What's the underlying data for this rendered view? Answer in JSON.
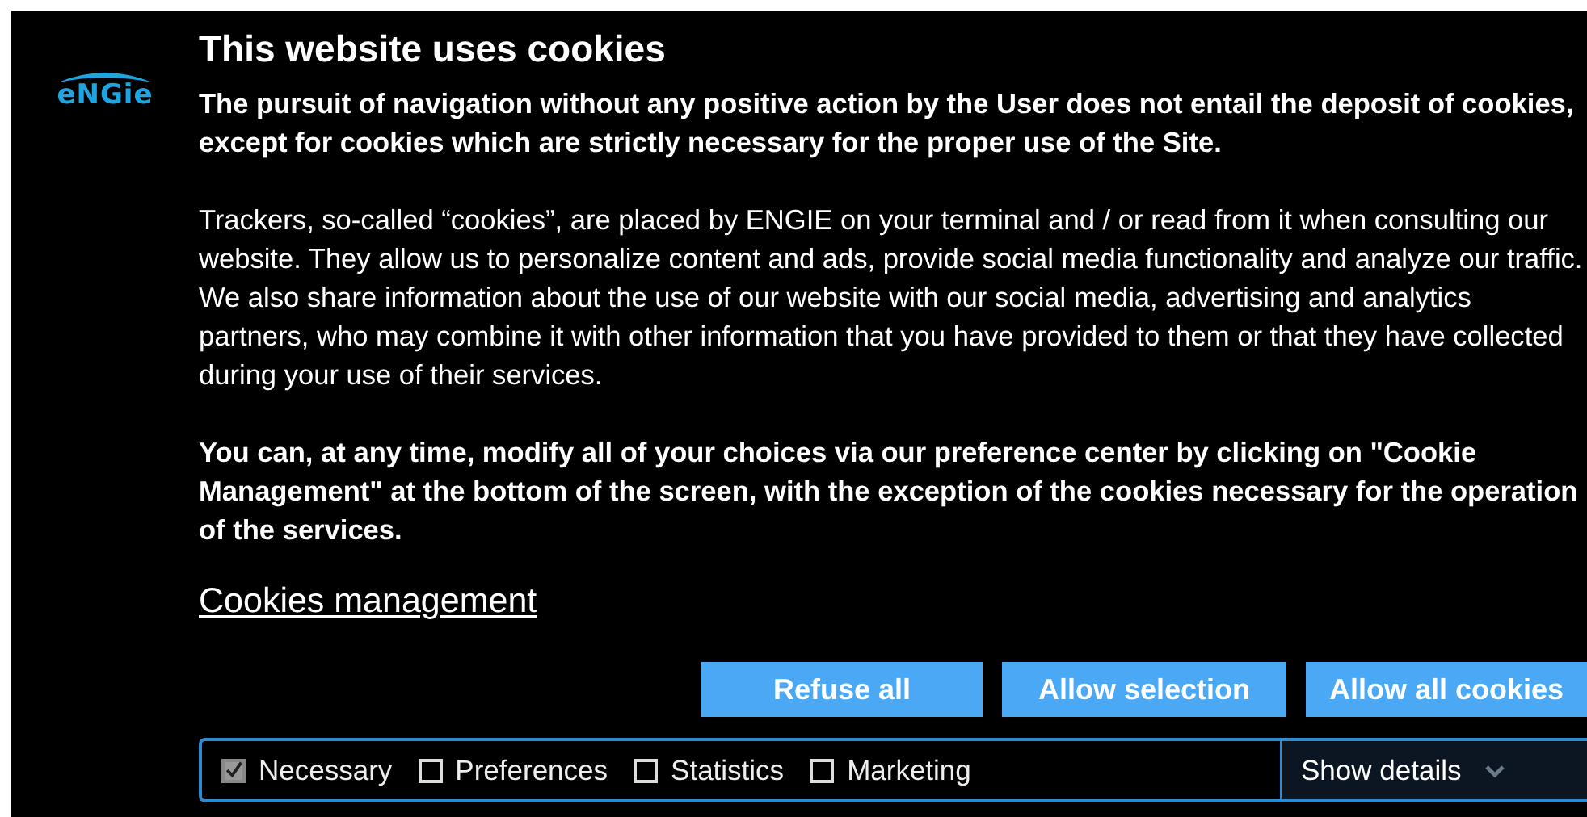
{
  "logo": "eNGie",
  "title": "This website uses cookies",
  "paragraphs": [
    {
      "kind": "bold",
      "text": "The pursuit of navigation without any positive action by the User does not entail the deposit of cookies, except for cookies which are strictly necessary for the proper use of the Site."
    },
    {
      "kind": "normal",
      "text": "Trackers, so-called “cookies”, are placed by ENGIE on your terminal and / or read from it when consulting our website. They allow us to personalize content and ads, provide social media functionality and analyze our traffic. We also share information about the use of our website with our social media, advertising and analytics partners, who may combine it with other information that you have provided to them or that they have collected during your use of their services."
    },
    {
      "kind": "bold",
      "text": "You can, at any time, modify all of your choices via our preference center by clicking on \"Cookie Management\" at the bottom of the screen, with the exception of the cookies necessary for the operation of the services."
    }
  ],
  "management_link": "Cookies management",
  "buttons": [
    "Refuse all",
    "Allow selection",
    "Allow all cookies"
  ],
  "categories": [
    {
      "label": "Necessary",
      "checked": true,
      "disabled": true
    },
    {
      "label": "Preferences",
      "checked": false,
      "disabled": false
    },
    {
      "label": "Statistics",
      "checked": false,
      "disabled": false
    },
    {
      "label": "Marketing",
      "checked": false,
      "disabled": false
    }
  ],
  "details_toggle": {
    "label": "Show details",
    "expanded": false
  }
}
